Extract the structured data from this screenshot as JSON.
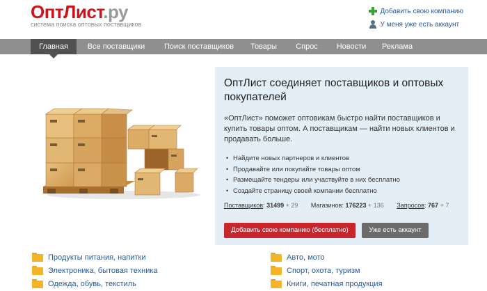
{
  "header": {
    "logo_brand": "ОптЛист",
    "logo_tld": ".ру",
    "tagline": "система поиска оптовых поставщиков",
    "add_company_link": "Добавить свою компанию",
    "have_account_link": "У меня уже есть аккаунт"
  },
  "nav": {
    "items": [
      {
        "label": "Главная",
        "active": true
      },
      {
        "label": "Все поставщики"
      },
      {
        "label": "Поиск поставщиков"
      },
      {
        "label": "Товары"
      },
      {
        "label": "Спрос"
      },
      {
        "label": "Новости"
      },
      {
        "label": "Реклама"
      }
    ]
  },
  "promo": {
    "title": "ОптЛист соединяет поставщиков и оптовых покупателей",
    "description": "«ОптЛист» поможет оптовикам быстро найти поставщиков и купить товары оптом. А поставщикам — найти новых клиентов и продавать больше.",
    "bullets": [
      "Найдите новых партнеров и клиентов",
      "Продавайте или покупайте товары оптом",
      "Размещайте тендеры или участвуйте в них бесплатно",
      "Создайте страницу своей компании бесплатно"
    ],
    "stats": {
      "suppliers_label": "Поставщиков",
      "suppliers_value": "31499",
      "suppliers_inc": "+ 29",
      "shops_label": "Магазинов:",
      "shops_value": "176223",
      "shops_inc": "+ 136",
      "requests_label": "Запросов",
      "requests_value": "767",
      "requests_inc": "+ 7"
    },
    "add_company_button": "Добавить свою компанию (бесплатно)",
    "have_account_button": "Уже есть аккаунт"
  },
  "categories": {
    "left": [
      "Продукты питания, напитки",
      "Электроника, бытовая техника",
      "Одежда, обувь, текстиль"
    ],
    "right": [
      "Авто, мото",
      "Спорт, охота, туризм",
      "Книги, печатная продукция"
    ]
  },
  "colors": {
    "brand_red": "#d0131b",
    "nav_bg": "#8f8f8f",
    "nav_active": "#515151",
    "promo_bg": "#e4eef7",
    "button_red": "#c7262c",
    "button_gray": "#6b6b6b",
    "link_blue": "#2a5a9a",
    "folder_yellow": "#f3b427"
  }
}
